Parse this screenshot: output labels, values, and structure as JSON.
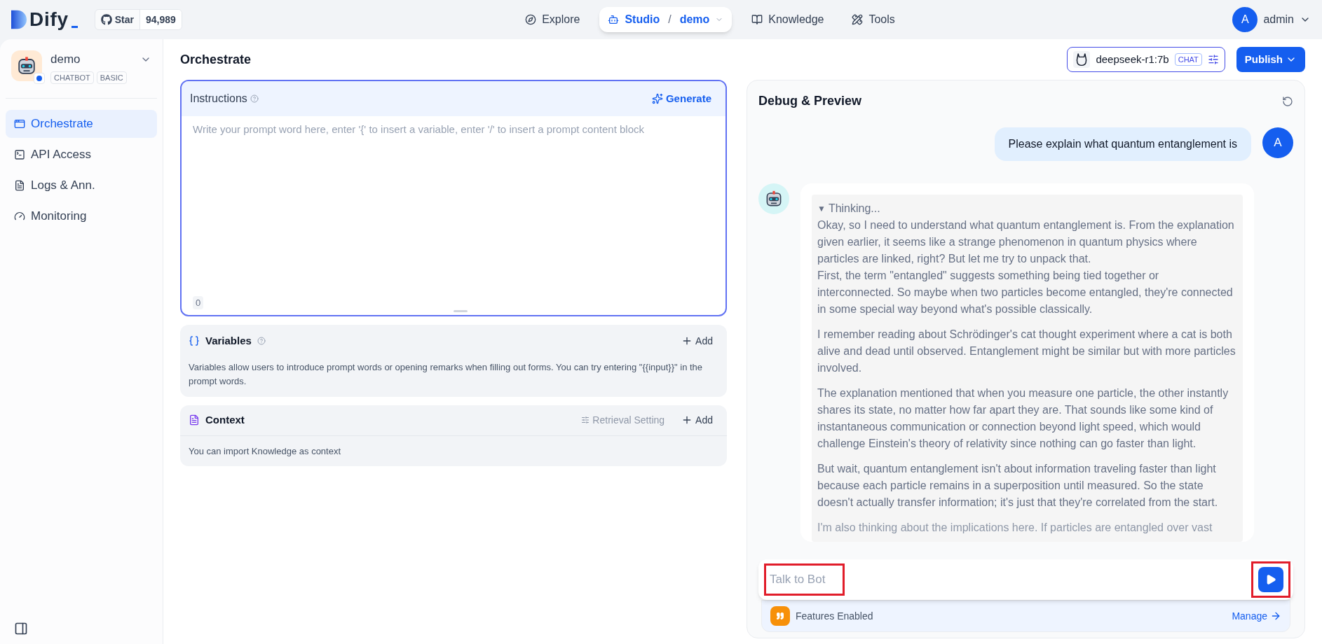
{
  "brand": {
    "logo": "Dify",
    "star_label": "Star",
    "star_count": "94,989"
  },
  "nav": [
    {
      "kind": "explore",
      "label": "Explore",
      "selected": false
    },
    {
      "kind": "studio",
      "label": "Studio",
      "separator": "/",
      "sub": "demo",
      "selected": true
    },
    {
      "kind": "knowledge",
      "label": "Knowledge",
      "selected": false
    },
    {
      "kind": "tools",
      "label": "Tools",
      "selected": false
    }
  ],
  "user": {
    "initial": "A",
    "name": "admin"
  },
  "app": {
    "name": "demo",
    "tags": [
      "CHATBOT",
      "BASIC"
    ]
  },
  "sidebar": {
    "items": [
      {
        "kind": "orchestrate",
        "label": "Orchestrate",
        "selected": true
      },
      {
        "kind": "api",
        "label": "API Access",
        "selected": false
      },
      {
        "kind": "logs",
        "label": "Logs & Ann.",
        "selected": false
      },
      {
        "kind": "monitoring",
        "label": "Monitoring",
        "selected": false
      }
    ]
  },
  "page_title": "Orchestrate",
  "model": {
    "name": "deepseek-r1:7b",
    "mode": "CHAT"
  },
  "publish": "Publish",
  "instructions": {
    "title": "Instructions",
    "generate": "Generate",
    "placeholder": "Write your prompt word here, enter '{' to insert a variable, enter '/' to insert a prompt content block",
    "count": "0"
  },
  "variables": {
    "title": "Variables",
    "add": "Add",
    "description": "Variables allow users to introduce prompt words or opening remarks when filling out forms. You can try entering \"{{input}}\" in the prompt words."
  },
  "context": {
    "title": "Context",
    "retrieval": "Retrieval Setting",
    "add": "Add",
    "description": "You can import Knowledge as context"
  },
  "debug": {
    "title": "Debug & Preview",
    "messages": [
      {
        "kind": "user",
        "avatar": "A",
        "text": "Please explain what quantum entanglement is"
      },
      {
        "kind": "bot",
        "disclosure": "▼",
        "thinking_label": "Thinking...",
        "expanded": true,
        "paragraphs": [
          "Okay, so I need to understand what quantum entanglement is. From the explanation given earlier, it seems like a strange phenomenon in quantum physics where particles are linked, right? But let me try to unpack that.\nFirst, the term \"entangled\" suggests something being tied together or interconnected. So maybe when two particles become entangled, they're connected in some special way beyond what's possible classically.",
          "I remember reading about Schrödinger's cat thought experiment where a cat is both alive and dead until observed. Entanglement might be similar but with more particles involved.",
          "The explanation mentioned that when you measure one particle, the other instantly shares its state, no matter how far apart they are. That sounds like some kind of instantaneous communication or connection beyond light speed, which would challenge Einstein's theory of relativity since nothing can go faster than light.",
          "But wait, quantum entanglement isn't about information traveling faster than light because each particle remains in a superposition until measured. So the state doesn't actually transfer information; it's just that they're correlated from the start.",
          "I'm also thinking about the implications here. If particles are entangled over vast"
        ]
      }
    ],
    "input_placeholder": "Talk to Bot",
    "features": {
      "label": "Features Enabled",
      "manage": "Manage"
    }
  }
}
